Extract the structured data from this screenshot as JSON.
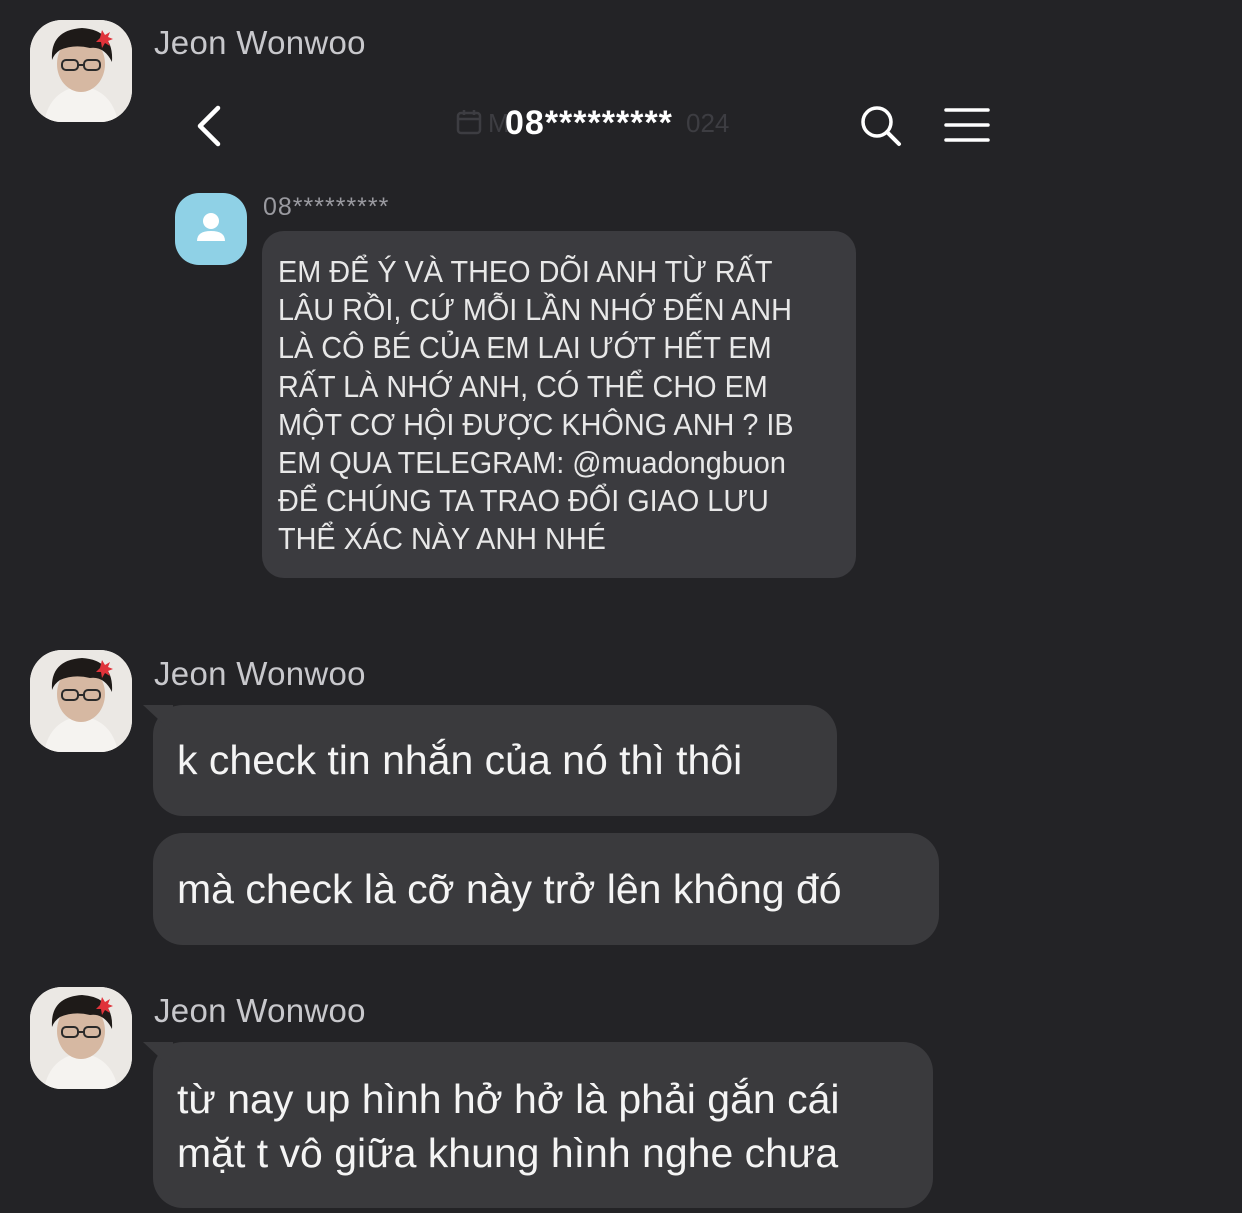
{
  "messages": [
    {
      "sender": "Jeon Wonwoo",
      "avatar_icon": "profile-photo",
      "attachment": {
        "kind": "sms-screenshot",
        "header_title": "08*********",
        "header_ghost_left": "M",
        "header_ghost_right": "024",
        "icons": [
          "back-chevron-icon",
          "search-icon",
          "menu-icon",
          "contact-avatar-icon",
          "calendar-icon"
        ],
        "sms_sender": "08*********",
        "sms_lines": [
          "EM ĐỂ Ý VÀ THEO DÕI ANH TỪ RẤT",
          "LÂU RỒI, CỨ MỖI LẦN NHỚ ĐẾN ANH",
          "LÀ CÔ BÉ CỦA EM LAI ƯỚT HẾT EM",
          "RẤT LÀ NHỚ ANH, CÓ THỂ CHO EM",
          "MỘT CƠ HỘI ĐƯỢC KHÔNG ANH ? IB",
          "EM QUA TELEGRAM: @muadongbuon",
          "ĐỂ CHÚNG TA TRAO ĐỔI GIAO LƯU",
          "THỂ XÁC NÀY ANH NHÉ"
        ]
      }
    },
    {
      "sender": "Jeon Wonwoo",
      "avatar_icon": "profile-photo",
      "bubbles": [
        "k check tin nhắn của nó thì thôi",
        "mà check là cỡ này trở lên không đó"
      ]
    },
    {
      "sender": "Jeon Wonwoo",
      "avatar_icon": "profile-photo",
      "bubbles": [
        "từ nay up hình hở hở là phải gắn cái",
        "mặt t vô giữa khung hình nghe chưa"
      ]
    }
  ],
  "colors": {
    "background": "#232326",
    "bubble": "#3a3a3d",
    "sender_name": "#c8c8cc",
    "contact_avatar": "#8fd1e6"
  }
}
